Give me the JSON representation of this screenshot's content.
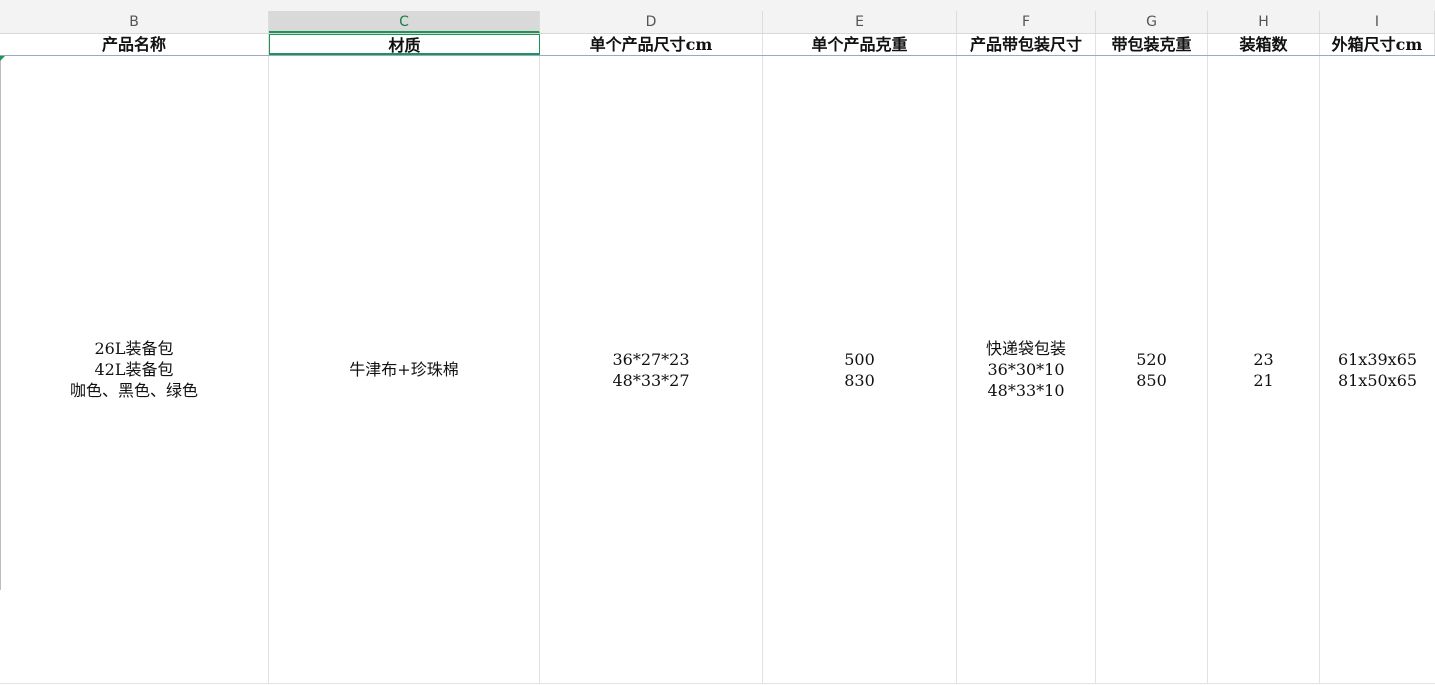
{
  "columns": [
    "B",
    "C",
    "D",
    "E",
    "F",
    "G",
    "H",
    "I"
  ],
  "selected_column": "C",
  "headers": {
    "B": "产品名称",
    "C": "材质",
    "D": "单个产品尺寸cm",
    "E": "单个产品克重",
    "F": "产品带包装尺寸",
    "G": "带包装克重",
    "H": "装箱数",
    "I": "外箱尺寸cm"
  },
  "row": {
    "B": [
      "26L装备包",
      "42L装备包",
      "咖色、黑色、绿色"
    ],
    "C": [
      "牛津布+珍珠棉"
    ],
    "D": [
      "36*27*23",
      "48*33*27"
    ],
    "E": [
      "500",
      "830"
    ],
    "F": [
      "快递袋包装",
      "36*30*10",
      "48*33*10"
    ],
    "G": [
      "520",
      "850"
    ],
    "H": [
      "23",
      "21"
    ],
    "I": [
      "61x39x65",
      "81x50x65"
    ]
  },
  "colors": {
    "accent_green": "#1e9457",
    "grid": "#e2e2e2",
    "header_bg": "#f3f3f3"
  }
}
